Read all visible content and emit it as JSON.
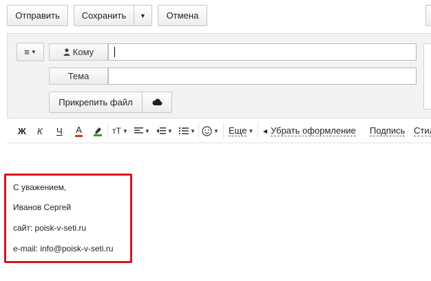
{
  "toolbar_top": {
    "send_label": "Отправить",
    "save_label": "Сохранить",
    "cancel_label": "Отмена"
  },
  "compose": {
    "to_label": "Кому",
    "to_value": "",
    "subject_label": "Тема",
    "subject_value": "",
    "attach_label": "Прикрепить файл"
  },
  "formatting": {
    "bold": "Ж",
    "italic": "К",
    "underline": "Ч",
    "text_color": "А",
    "font_size": "тТ",
    "more_label": "Еще",
    "clear_format_label": "Убрать оформление",
    "signature_label": "Подпись",
    "style_label": "Стил"
  },
  "signature": {
    "lines": [
      "С уважением,",
      "Иванов Сергей",
      "сайт: poisk-v-seti.ru",
      "e-mail: info@poisk-v-seti.ru"
    ]
  },
  "colors": {
    "highlight_border": "#d9131e",
    "text_color_accent": "#e0301e",
    "highlighter_accent": "#2e9e2e"
  }
}
